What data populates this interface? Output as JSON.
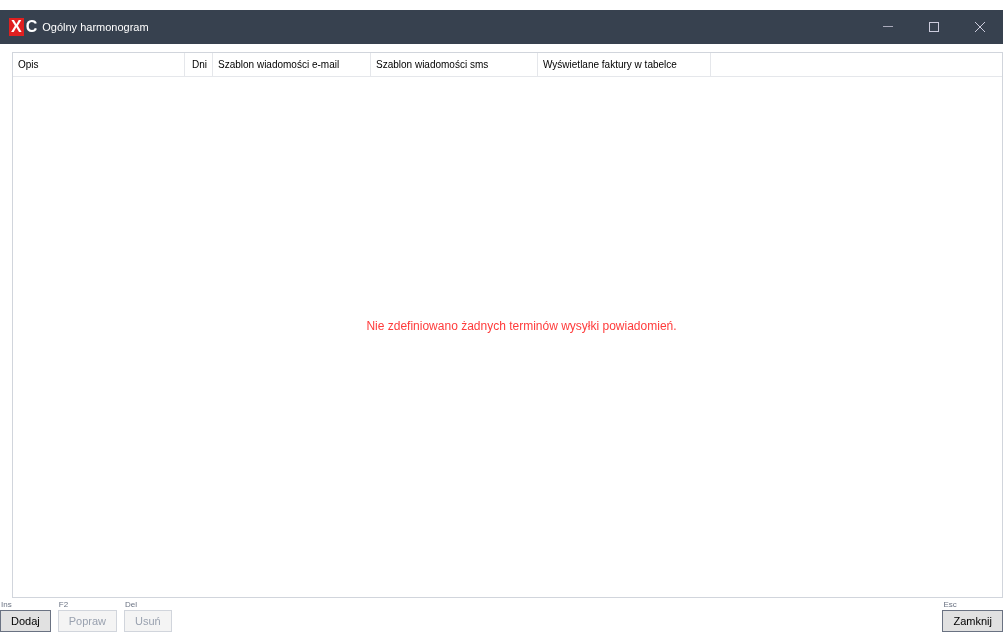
{
  "window": {
    "title": "Ogólny harmonogram",
    "logo": [
      "X",
      "C"
    ]
  },
  "table": {
    "columns": [
      "Opis",
      "Dni",
      "Szablon wiadomości e-mail",
      "Szablon wiadomości sms",
      "Wyświetlane faktury w tabelce"
    ],
    "empty_message": "Nie zdefiniowano żadnych terminów wysyłki powiadomień."
  },
  "buttons_left": [
    {
      "shortcut": "Ins",
      "label": "Dodaj",
      "disabled": false
    },
    {
      "shortcut": "F2",
      "label": "Popraw",
      "disabled": true
    },
    {
      "shortcut": "Del",
      "label": "Usuń",
      "disabled": true
    }
  ],
  "button_right": {
    "shortcut": "Esc",
    "label": "Zamknij",
    "disabled": false
  }
}
